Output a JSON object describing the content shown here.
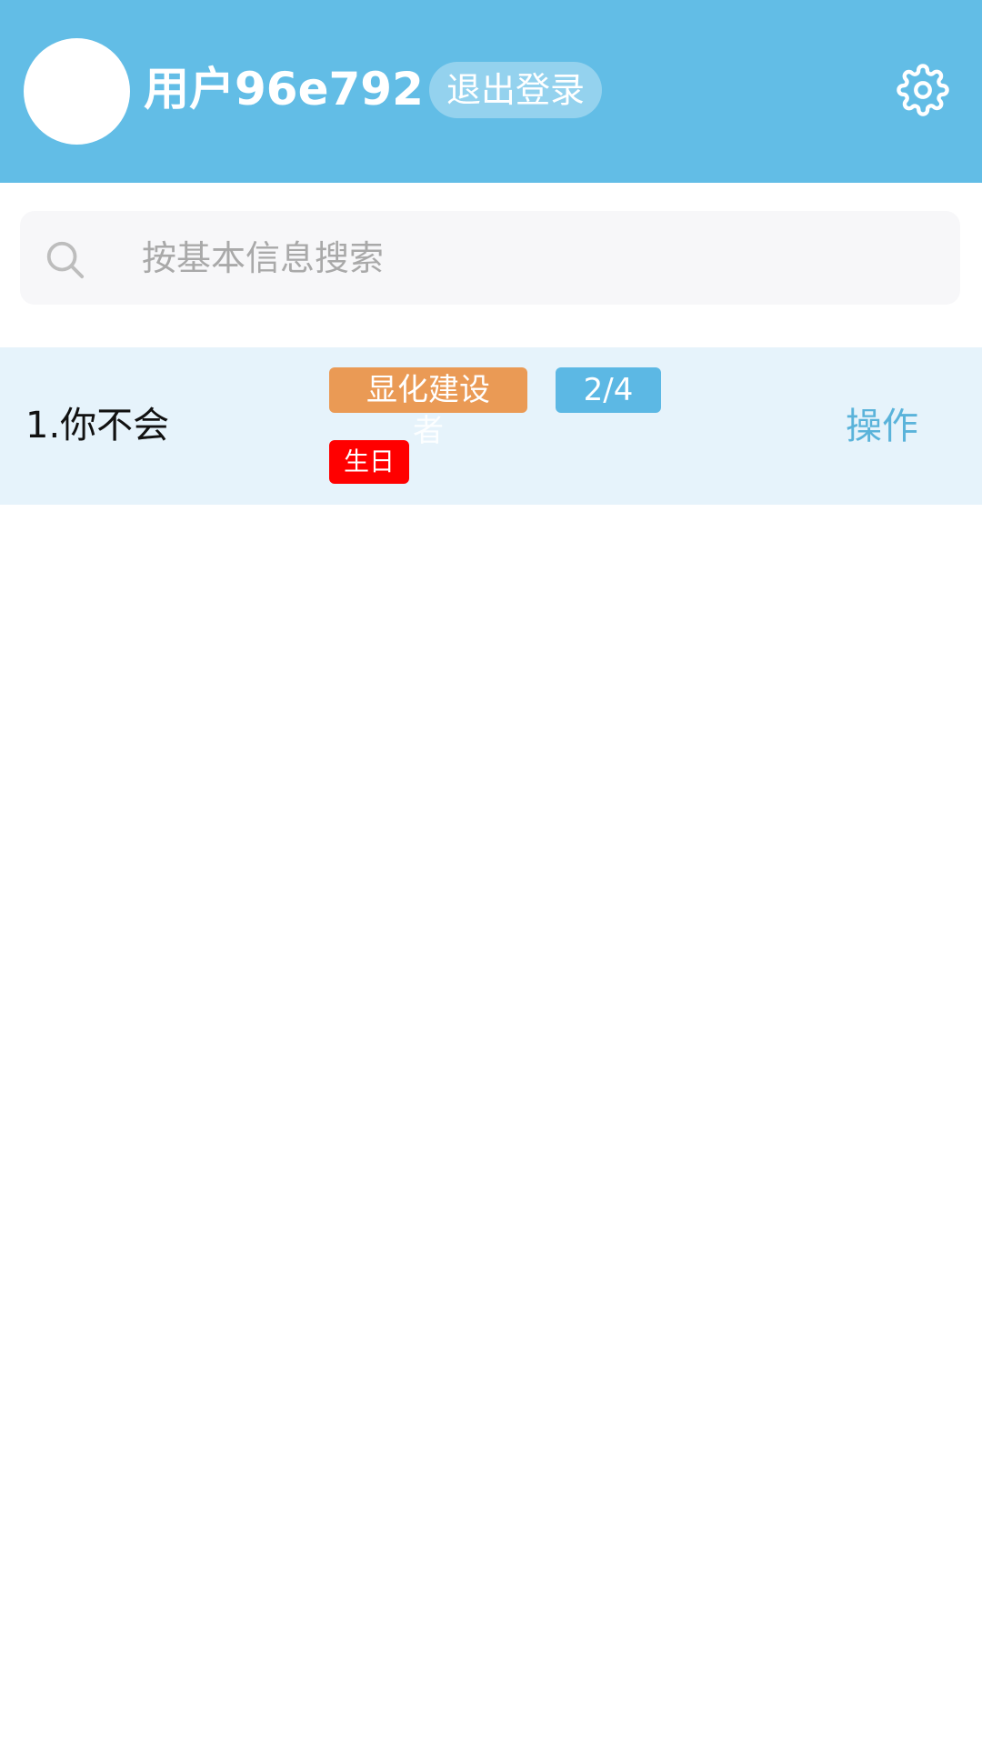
{
  "header": {
    "username": "用户96e792",
    "logout_label": "退出登录",
    "bg_color": "#62bde6"
  },
  "search": {
    "placeholder": "按基本信息搜索",
    "value": ""
  },
  "list": {
    "items": [
      {
        "title": "1.你不会",
        "tag_primary": "显化建设",
        "tag_primary_overflow": "者",
        "progress": "2/4",
        "tag_secondary": "生日",
        "action_label": "操作"
      }
    ]
  },
  "icons": {
    "settings": "gear-icon",
    "search": "search-icon"
  },
  "colors": {
    "tag_orange": "#ea9a55",
    "tag_blue": "#5cb8e4",
    "tag_red": "#ff0000",
    "action_text": "#5ab3da",
    "row_bg": "#e6f3fb"
  }
}
